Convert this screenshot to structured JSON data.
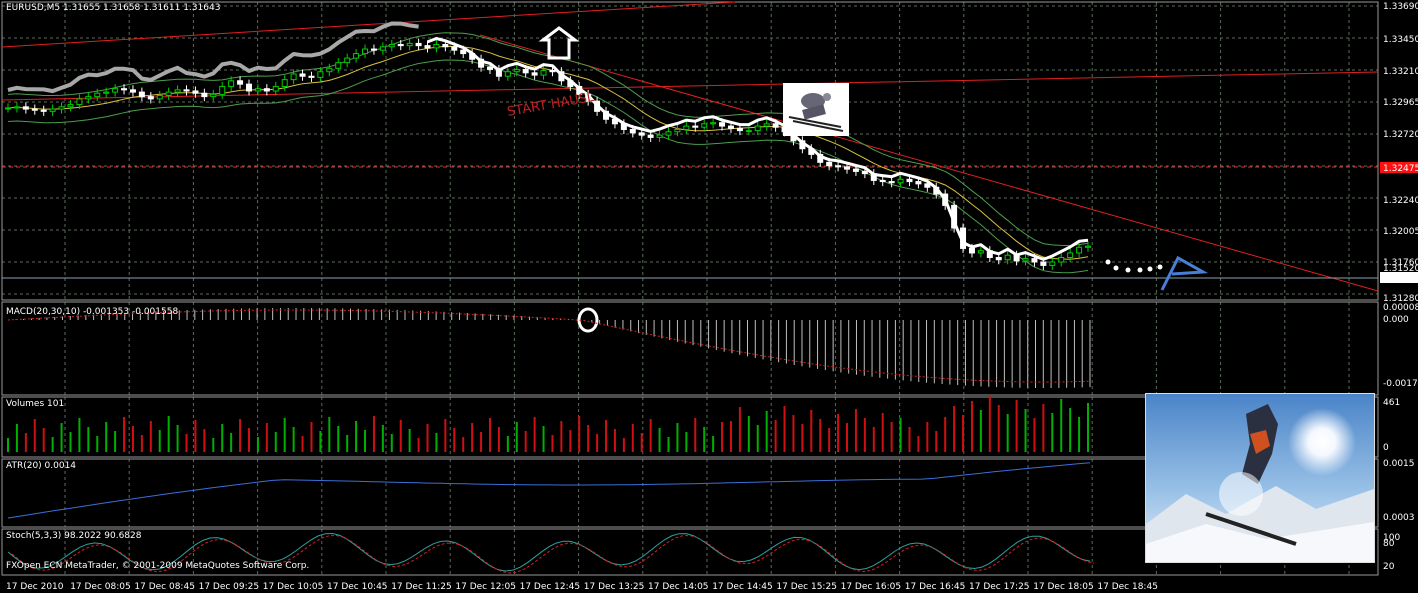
{
  "main_header": "EURUSD,M5  1.31655 1.31658 1.31611 1.31643",
  "annotations": {
    "start_text": "START HAUSL"
  },
  "price_axis": {
    "ticks": [
      "1.33690",
      "1.33450",
      "1.33210",
      "1.32965",
      "1.32720",
      "1.32475",
      "1.32240",
      "1.32005",
      "1.31760",
      "1.31643",
      "1.31520",
      "1.31280"
    ],
    "current": "1.31643",
    "marked": "1.32475"
  },
  "macd": {
    "header": "MACD(20,30,10) -0.001353 -0.001558",
    "ticks": [
      "0.000082",
      "0.000",
      "-0.00177"
    ]
  },
  "volumes": {
    "header": "Volumes 101",
    "ticks": [
      "461",
      "0"
    ]
  },
  "atr": {
    "header": "ATR(20) 0.0014",
    "ticks": [
      "0.0015",
      "0.0003"
    ]
  },
  "stoch": {
    "header": "Stoch(5,3,3) 98.2022 90.6828",
    "ticks": [
      "100",
      "80",
      "20"
    ]
  },
  "time_axis": [
    "17 Dec 2010",
    "17 Dec 08:05",
    "17 Dec 08:45",
    "17 Dec 09:25",
    "17 Dec 10:05",
    "17 Dec 10:45",
    "17 Dec 11:25",
    "17 Dec 12:05",
    "17 Dec 12:45",
    "17 Dec 13:25",
    "17 Dec 14:05",
    "17 Dec 14:45",
    "17 Dec 15:25",
    "17 Dec 16:05",
    "17 Dec 16:45",
    "17 Dec 17:25",
    "17 Dec 18:05",
    "17 Dec 18:45"
  ],
  "copyright": "FXOpen ECN MetaTrader, © 2001-2009 MetaQuotes Software Corp.",
  "colors": {
    "bull": "#00cc00",
    "bear": "#ffffff",
    "grid": "#5a6b5a",
    "trend": "#e02020",
    "macd": "#c0c0c0",
    "atr": "#3b6fd8",
    "vol_up": "#00b000",
    "vol_down": "#d01010"
  },
  "chart_data": {
    "type": "candlestick",
    "symbol": "EURUSD",
    "timeframe": "M5",
    "ylim": [
      1.312,
      1.3376
    ],
    "close": [
      1.3286,
      1.3287,
      1.3285,
      1.3284,
      1.3283,
      1.3285,
      1.3287,
      1.3289,
      1.3294,
      1.3296,
      1.3299,
      1.33,
      1.3303,
      1.3302,
      1.33,
      1.3296,
      1.3294,
      1.3297,
      1.33,
      1.3302,
      1.3301,
      1.3299,
      1.3296,
      1.3298,
      1.3305,
      1.331,
      1.3307,
      1.3301,
      1.3303,
      1.3301,
      1.3305,
      1.3311,
      1.3316,
      1.3314,
      1.3313,
      1.3318,
      1.3321,
      1.3326,
      1.333,
      1.3334,
      1.3338,
      1.3337,
      1.334,
      1.3342,
      1.3341,
      1.3343,
      1.3341,
      1.3339,
      1.3342,
      1.334,
      1.3337,
      1.3334,
      1.3329,
      1.3322,
      1.332,
      1.3314,
      1.3318,
      1.332,
      1.3317,
      1.3315,
      1.3319,
      1.3318,
      1.331,
      1.3305,
      1.3298,
      1.3292,
      1.3283,
      1.3276,
      1.3272,
      1.3267,
      1.3264,
      1.3262,
      1.326,
      1.3262,
      1.3265,
      1.3267,
      1.327,
      1.3269,
      1.3272,
      1.3273,
      1.327,
      1.3268,
      1.3266,
      1.3266,
      1.327,
      1.3272,
      1.3269,
      1.3265,
      1.3257,
      1.325,
      1.3245,
      1.3238,
      1.3235,
      1.3234,
      1.3232,
      1.323,
      1.3228,
      1.3222,
      1.3221,
      1.322,
      1.3223,
      1.3221,
      1.3219,
      1.3216,
      1.321,
      1.32,
      1.318,
      1.3162,
      1.3158,
      1.316,
      1.3154,
      1.3152,
      1.3156,
      1.3151,
      1.3153,
      1.315,
      1.3147,
      1.315,
      1.3154,
      1.3158,
      1.3163,
      1.3164
    ]
  }
}
